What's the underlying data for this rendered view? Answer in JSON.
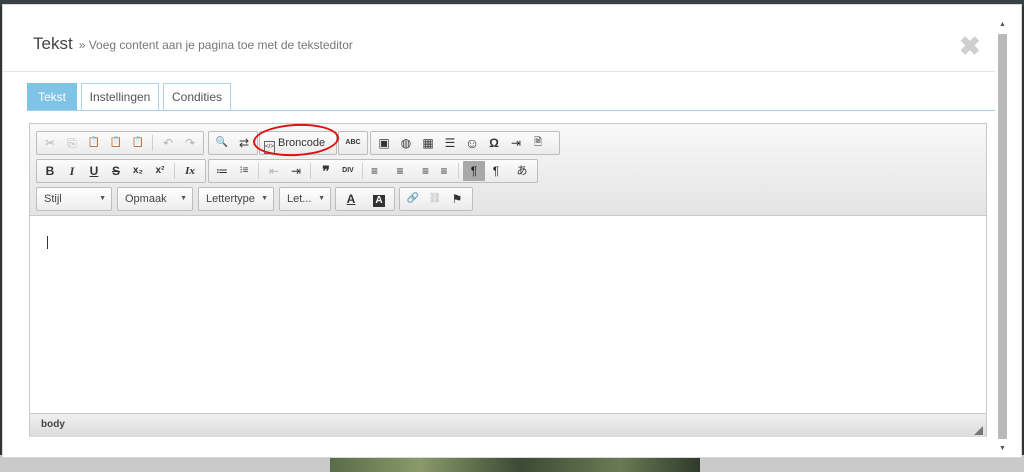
{
  "modal": {
    "title": "Tekst",
    "subtitle": "» Voeg content aan je pagina toe met de teksteditor",
    "close_icon": "✖"
  },
  "tabs": [
    {
      "label": "Tekst",
      "active": true
    },
    {
      "label": "Instellingen",
      "active": false
    },
    {
      "label": "Condities",
      "active": false
    }
  ],
  "toolbar": {
    "source_label": "Broncode",
    "style_combo": "Stijl",
    "format_combo": "Opmaak",
    "font_combo": "Lettertype",
    "size_combo": "Let..."
  },
  "icons": {
    "cut": "✂",
    "copy": "⎘",
    "paste": "📋",
    "paste_text": "📋",
    "paste_word": "📋",
    "undo": "↶",
    "redo": "↷",
    "find": "🔍",
    "replace": "⇄",
    "spellcheck": "ABC",
    "image": "▣",
    "flash": "◍",
    "table": "▦",
    "hr": "☰",
    "smiley": "☺",
    "special_char": "Ω",
    "page_break": "⇥",
    "template": "🗎",
    "bold": "B",
    "italic": "I",
    "underline": "U",
    "strike": "S",
    "subscript": "x₂",
    "superscript": "x²",
    "remove_format": "Ix",
    "numbered_list": "≔",
    "bulleted_list": "⁝≡",
    "outdent": "⇤",
    "indent": "⇥",
    "blockquote": "❞",
    "div": "DIV",
    "align_left": "≡",
    "align_center": "≡",
    "align_right": "≡",
    "justify": "≡",
    "ltr": "¶",
    "rtl": "¶",
    "language": "あ",
    "text_color": "A",
    "bg_color": "A",
    "link": "🔗",
    "unlink": "⛓",
    "anchor": "⚑"
  },
  "status": {
    "path": "body"
  }
}
